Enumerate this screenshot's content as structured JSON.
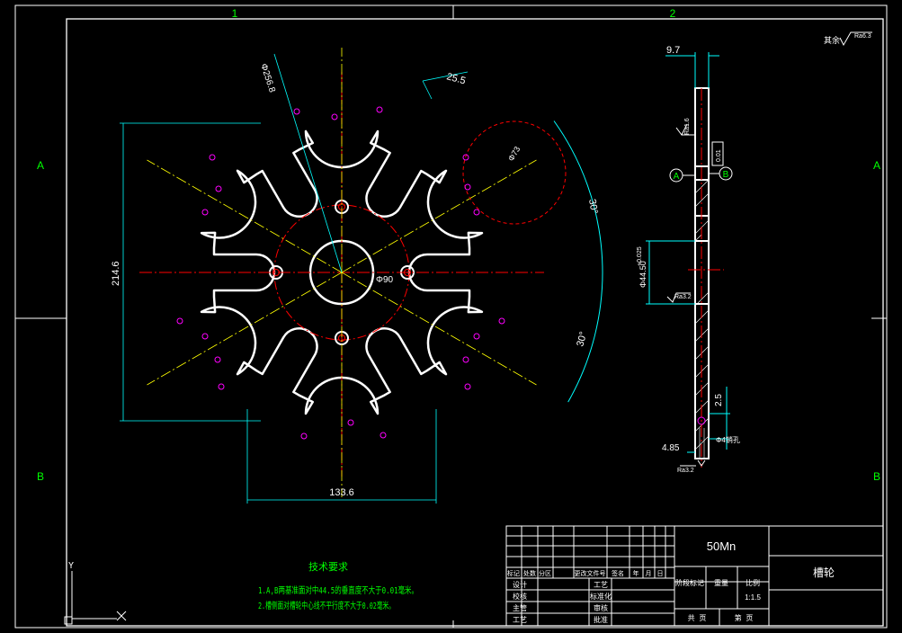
{
  "frame": {
    "zone_cols": [
      "1",
      "2"
    ],
    "zone_rows": [
      "A",
      "B"
    ],
    "colors": {
      "background": "#000000",
      "white": "#ffffff",
      "green": "#00ff00",
      "cyan": "#00ffff",
      "red": "#ff0000",
      "magenta": "#ff00ff",
      "yellow": "#ffff00"
    }
  },
  "roughness_note": {
    "prefix": "其余",
    "value": "Ra6.3"
  },
  "dimensions": {
    "outer_dia": "Φ256.8",
    "slot_width": "25.5",
    "circle_dia": "Φ73",
    "angle_top": "30°",
    "angle_bottom": "30°",
    "height": "214.6",
    "bore": "Φ90",
    "width": "133.6",
    "thickness": "9.7",
    "hub_dia": "Φ44.50",
    "hub_tol": "+0.025",
    "chamfer": "2.5",
    "pin_offset": "4.85",
    "pin_hole": "Φ4销孔"
  },
  "roughness": {
    "r1": "Ra1.6",
    "r2": "Ra3.2",
    "r3": "Ra3.2"
  },
  "perp_tol": "0.01",
  "datum_a": "A",
  "datum_b": "B",
  "tech": {
    "title": "技术要求",
    "line1": "1.A,B两基准面对中44.5的垂直度不大于0.01毫米。",
    "line2": "2.槽侧面对槽轮中心线不平行度不大于0.02毫米。"
  },
  "title_block": {
    "material": "50Mn",
    "part_name": "槽轮",
    "rev_headers": [
      "标记",
      "处数",
      "分区",
      "更改文件号",
      "签名",
      "年",
      "月",
      "日"
    ],
    "stage_label": "阶段标记",
    "weight_label": "重量",
    "scale_label": "比例",
    "scale": "1:1.5",
    "roles": [
      "设计",
      "校核",
      "主管",
      "工艺"
    ],
    "roles2": [
      "工艺",
      "标准化",
      "审核",
      "批准"
    ],
    "sheet_total": "共  页",
    "sheet_no": "第  页"
  },
  "ucs": {
    "y": "Y",
    "x": "X"
  }
}
